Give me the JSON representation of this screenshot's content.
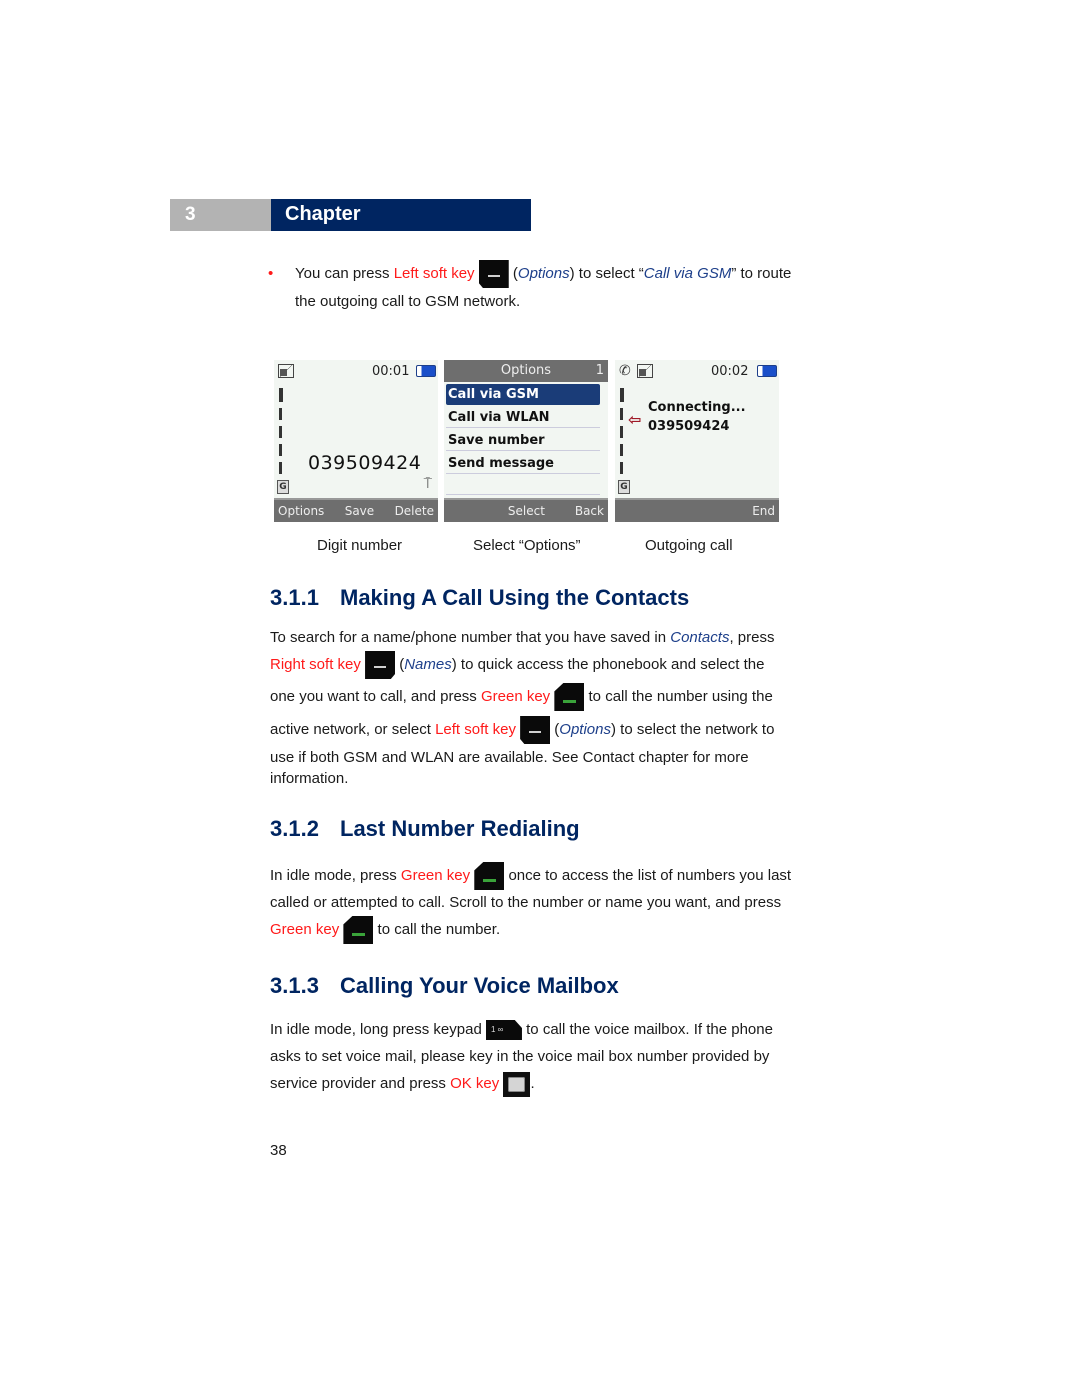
{
  "chapter": {
    "number": "3",
    "title": "Chapter"
  },
  "bullet": {
    "before": "You can press ",
    "key_label": "Left soft key",
    "options": "Options",
    "middle": ") to select “",
    "target": "Call via GSM",
    "after": "” to route the outgoing call to GSM network."
  },
  "screens": [
    {
      "caption": "Digit number",
      "time": "00:01",
      "number": "039509424",
      "softkeys": [
        "Options",
        "Save",
        "Delete"
      ]
    },
    {
      "caption": "Select “Options”",
      "header": "Options",
      "index": "1",
      "items": [
        "Call via GSM",
        "Call via WLAN",
        "Save number",
        "Send message"
      ],
      "selected": 0,
      "softkeys": [
        "",
        "Select",
        "Back"
      ]
    },
    {
      "caption": "Outgoing call",
      "time": "00:02",
      "status": "Connecting...",
      "number": "039509424",
      "softkeys": [
        "",
        "",
        "End"
      ]
    }
  ],
  "sections": [
    {
      "num": "3.1.1",
      "title": "Making A Call Using the Contacts",
      "p1": "To search for a name/phone number that you have saved in ",
      "contacts": "Contacts",
      "p2": ", press",
      "right_key": "Right soft key",
      "names": "Names",
      "p3": ") to quick access the phonebook and select the",
      "p4": "one you want to call, and press ",
      "green_key": "Green key",
      "p5": " to call the number using the",
      "p6": "active network, or select ",
      "left_key": "Left soft key",
      "options": "Options",
      "p7": ") to select the network to",
      "p8": "use if both GSM and WLAN are available. See Contact chapter for more",
      "p9": "information."
    },
    {
      "num": "3.1.2",
      "title": "Last Number Redialing",
      "p1": "In idle mode, press ",
      "green_key": "Green key",
      "p2": " once to access the list of numbers you last",
      "p3": "called or attempted to call. Scroll to the number or name you want, and press",
      "p4": " to call the number."
    },
    {
      "num": "3.1.3",
      "title": "Calling Your Voice Mailbox",
      "p1": "In idle mode, long press keypad ",
      "keypad_label": "1 ∞",
      "p2": " to call the voice mailbox. If the phone",
      "p3": "asks to set voice mail, please key in the voice mail box number provided by",
      "p4": "service provider and press ",
      "ok_key": "OK key",
      "p5": "."
    }
  ],
  "page_number": "38"
}
